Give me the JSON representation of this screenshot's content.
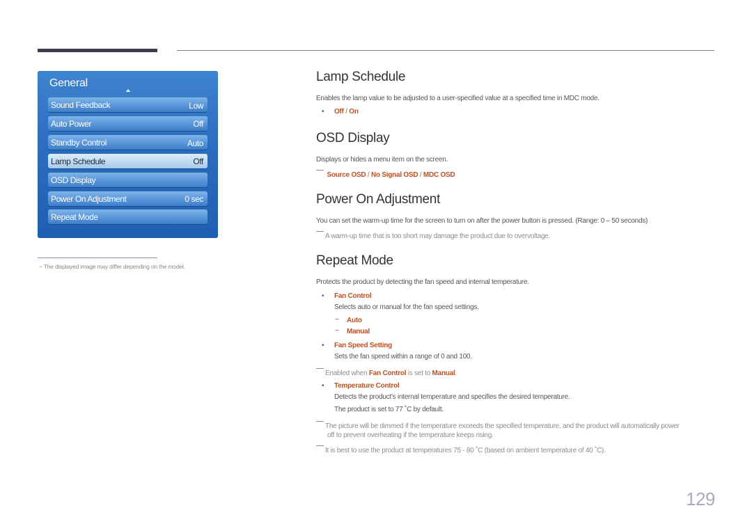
{
  "menu": {
    "title": "General",
    "items": [
      {
        "label": "Sound Feedback",
        "value": "Low"
      },
      {
        "label": "Auto Power",
        "value": "Off"
      },
      {
        "label": "Standby Control",
        "value": "Auto"
      },
      {
        "label": "Lamp Schedule",
        "value": "Off",
        "selected": true
      },
      {
        "label": "OSD Display",
        "value": ""
      },
      {
        "label": "Power On Adjustment",
        "value": "0 sec"
      },
      {
        "label": "Repeat Mode",
        "value": ""
      }
    ]
  },
  "footnote": "−  The displayed image may differ depending on the model.",
  "sections": {
    "lamp_schedule": {
      "title": "Lamp Schedule",
      "desc": "Enables the lamp value to be adjusted to a user-specified value at a specified time in MDC mode.",
      "options": [
        "Off",
        "On"
      ]
    },
    "osd_display": {
      "title": "OSD Display",
      "desc": "Displays or hides a menu item on the screen.",
      "options": [
        "Source OSD",
        "No Signal OSD",
        "MDC OSD"
      ]
    },
    "power_on_adjustment": {
      "title": "Power On Adjustment",
      "desc": "You can set the warm-up time for the screen to turn on after the power button is pressed. (Range: 0 – 50 seconds)",
      "note": "A warm-up time that is too short may damage the product due to overvoltage."
    },
    "repeat_mode": {
      "title": "Repeat Mode",
      "desc": "Protects the product by detecting the fan speed and internal temperature.",
      "fan_control": {
        "label": "Fan Control",
        "desc": "Selects auto or manual for the fan speed settings.",
        "options": [
          "Auto",
          "Manual"
        ]
      },
      "fan_speed_setting": {
        "label": "Fan Speed Setting",
        "desc": "Sets the fan speed within a range of 0 and 100."
      },
      "fan_speed_note": {
        "prefix": "Enabled when ",
        "term1": "Fan Control",
        "middle": " is set to ",
        "term2": "Manual",
        "suffix": "."
      },
      "temperature_control": {
        "label": "Temperature Control",
        "desc": "Detects the product's internal temperature and specifies the desired temperature.",
        "default": "The product is set to 77 ˚C by default."
      },
      "note1_line1": "The picture will be dimmed if the temperature exceeds the specified temperature, and the product will automatically power",
      "note1_line2": "off to prevent overheating if the temperature keeps rising.",
      "note2": "It is best to use the product at temperatures 75 - 80 ˚C (based on ambient temperature of 40 ˚C)."
    }
  },
  "separator": "/",
  "bullet": "•",
  "dash": "−",
  "page_number": "129"
}
